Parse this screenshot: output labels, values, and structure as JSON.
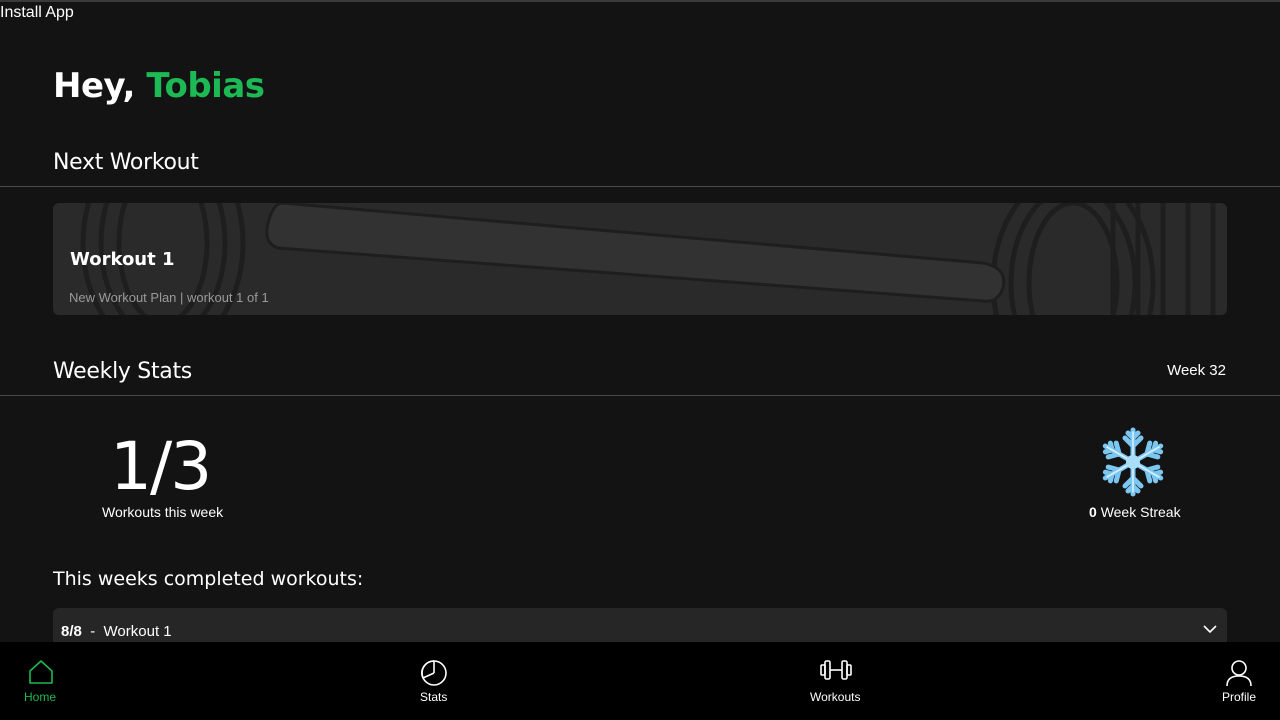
{
  "install_app": "Install App",
  "greeting": {
    "prefix": "Hey,",
    "name": "Tobias"
  },
  "next_workout": {
    "section_title": "Next Workout",
    "card": {
      "title": "Workout 1",
      "subtitle": "New Workout Plan | workout 1 of 1"
    }
  },
  "weekly_stats": {
    "section_title": "Weekly Stats",
    "week_label": "Week 32",
    "workouts_value": "1/3",
    "workouts_caption": "Workouts this week",
    "streak_icon": "snowflake-icon",
    "streak_count": "0",
    "streak_label": "Week Streak"
  },
  "completed": {
    "title": "This weeks completed workouts:",
    "rows": [
      {
        "date": "8/8",
        "separator": "-",
        "name": "Workout 1"
      }
    ]
  },
  "nav": {
    "items": [
      {
        "label": "Home",
        "icon": "home-icon",
        "active": true
      },
      {
        "label": "Stats",
        "icon": "pie-chart-icon",
        "active": false
      },
      {
        "label": "Workouts",
        "icon": "dumbbell-icon",
        "active": false
      },
      {
        "label": "Profile",
        "icon": "user-icon",
        "active": false
      }
    ]
  },
  "colors": {
    "background": "#131313",
    "accent": "#1db954",
    "card": "#2a2a2a",
    "nav_background": "#000000"
  }
}
